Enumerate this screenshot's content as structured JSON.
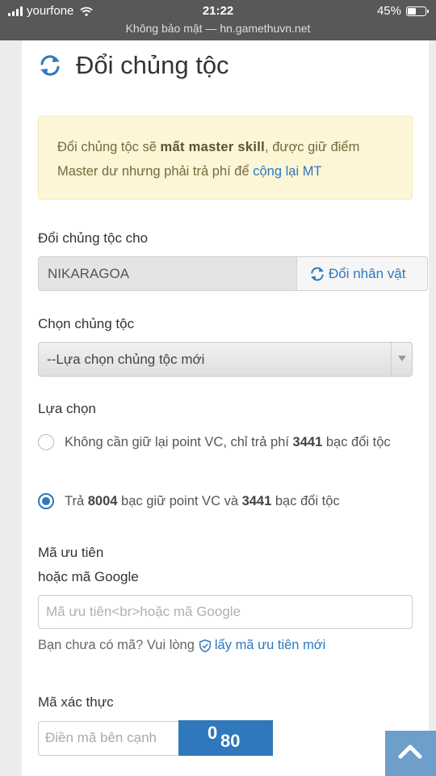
{
  "status_bar": {
    "carrier": "yourfone",
    "time": "21:22",
    "battery": "45%",
    "battery_level": 0.45,
    "url": "Không bảo mật — hn.gamethuvn.net"
  },
  "page": {
    "title": "Đổi chủng tộc",
    "icon": "refresh-icon"
  },
  "notice": {
    "part1": "Đổi chủng tộc sẽ ",
    "bold": "mất master skill",
    "part2": ", được giữ điểm Master dư nhưng phải trả phí để ",
    "link": "cộng lại MT"
  },
  "character": {
    "label": "Đổi chủng tộc cho",
    "value": "NIKARAGOA",
    "button_label": "Đổi nhân vật"
  },
  "race": {
    "label": "Chọn chủng tộc",
    "selected": "--Lựa chọn chủng tộc mới"
  },
  "options": {
    "label": "Lựa chọn",
    "option1": {
      "t1": "Không cần giữ lại point VC, chỉ trả phí ",
      "b1": "3441",
      "t2": " bạc đổi tộc",
      "selected": false
    },
    "option2": {
      "t1": "Trả ",
      "b1": "8004",
      "t2": " bạc giữ point VC và ",
      "b2": "3441",
      "t3": " bạc đổi tộc",
      "selected": true
    }
  },
  "code": {
    "label_line1": "Mã ưu tiên",
    "label_line2": "hoặc mã Google",
    "placeholder": "Mã ưu tiên<br>hoặc mã Google",
    "helper_text": "Bạn chưa có mã? Vui lòng",
    "helper_link": "lấy mã ưu tiên mới"
  },
  "captcha": {
    "label": "Mã xác thực",
    "placeholder": "Điền mã bên cạnh",
    "char1": "0",
    "char2": "80"
  },
  "colors": {
    "accent": "#2f78bb",
    "notice_bg": "#fcf6d6",
    "scroll_top_bg": "#6e9fcb"
  }
}
